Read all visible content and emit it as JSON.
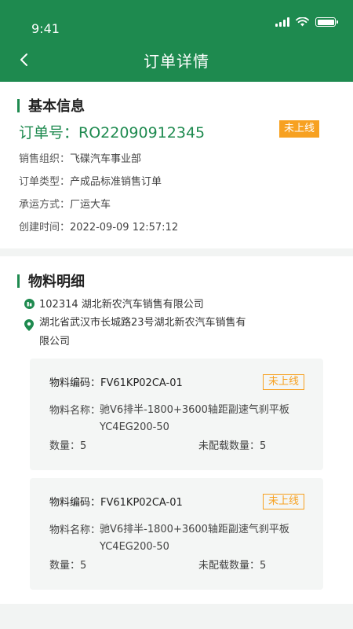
{
  "status_bar": {
    "time": "9:41"
  },
  "header": {
    "title": "订单详情"
  },
  "basic": {
    "section_title": "基本信息",
    "order_no": "订单号：RO22090912345",
    "status_badge": "未上线",
    "rows": [
      {
        "label": "销售组织：",
        "value": "飞碟汽车事业部"
      },
      {
        "label": "订单类型：",
        "value": "产成品标准销售订单"
      },
      {
        "label": "承运方式：",
        "value": "厂运大车"
      },
      {
        "label": "创建时间：",
        "value": "2022-09-09  12:57:12"
      }
    ]
  },
  "materials": {
    "section_title": "物料明细",
    "company": "102314    湖北新农汽车销售有限公司",
    "address_line1": "湖北省武汉市长城路23号湖北新农汽车销售有",
    "address_line2": "限公司",
    "items": [
      {
        "code": "物料编码：FV61KP02CA-01",
        "badge": "未上线",
        "name_label": "物料名称：",
        "name_line1": "驰V6排半-1800+3600轴距副速气刹平板",
        "name_line2": "YC4EG200-50",
        "qty": "数量：5",
        "unloaded": "未配载数量：5"
      },
      {
        "code": "物料编码：FV61KP02CA-01",
        "badge": "未上线",
        "name_label": "物料名称：",
        "name_line1": "驰V6排半-1800+3600轴距副速气刹平板",
        "name_line2": "YC4EG200-50",
        "qty": "数量：5",
        "unloaded": "未配载数量：5"
      }
    ]
  },
  "colors": {
    "brand": "#1e8a4f",
    "badge": "#f7a121",
    "background": "#f2f4f3"
  },
  "icons": [
    "back-arrow-icon",
    "signal-icon",
    "wifi-icon",
    "battery-icon",
    "building-icon",
    "location-pin-icon"
  ]
}
